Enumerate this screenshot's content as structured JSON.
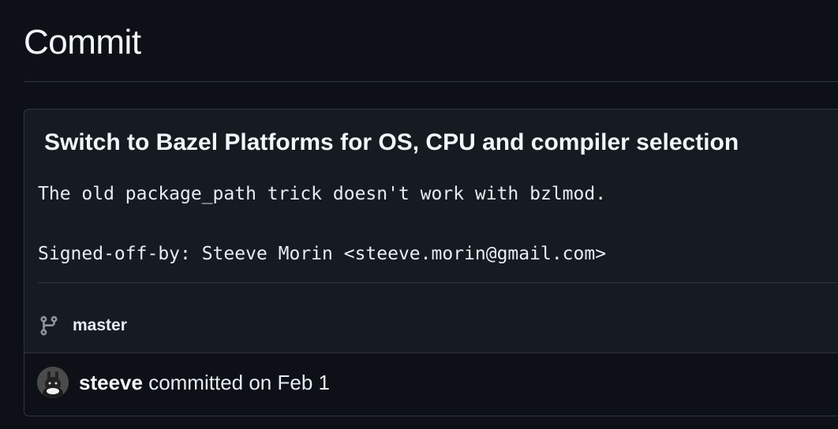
{
  "page": {
    "title": "Commit"
  },
  "commit": {
    "title": "Switch to Bazel Platforms for OS, CPU and compiler selection",
    "description": "The old package_path trick doesn't work with bzlmod.\n\nSigned-off-by: Steeve Morin <steeve.morin@gmail.com>",
    "branch": "master",
    "author": "steeve",
    "committed_text": " committed on Feb 1",
    "icons": {
      "branch": "git-branch-icon",
      "avatar": "user-avatar"
    }
  },
  "colors": {
    "background": "#0d1117",
    "box_background": "#161b22",
    "border": "#30363d",
    "text": "#e6edf3"
  }
}
